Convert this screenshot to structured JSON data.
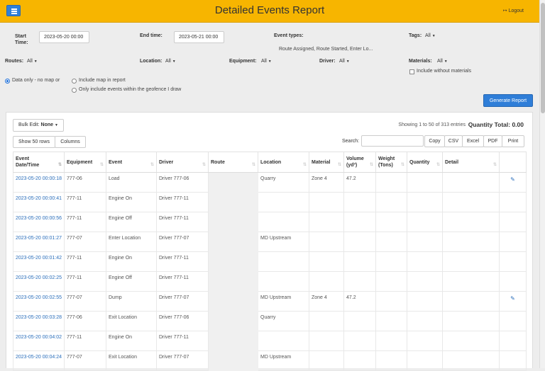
{
  "header": {
    "title": "Detailed Events Report",
    "logout_label": "Logout"
  },
  "filters": {
    "start_time_label": "Start Time:",
    "start_time_value": "2023-05-20 00:00",
    "end_time_label": "End time:",
    "end_time_value": "2023-05-21 00:00",
    "event_types_label": "Event types:",
    "event_types_value": "Route Assigned, Route Started, Enter Lo...",
    "tags_label": "Tags:",
    "tags_value": "All",
    "routes_label": "Routes:",
    "routes_value": "All",
    "location_label": "Location:",
    "location_value": "All",
    "equipment_label": "Equipment:",
    "equipment_value": "All",
    "driver_label": "Driver:",
    "driver_value": "All",
    "materials_label": "Materials:",
    "materials_value": "All",
    "include_without_materials": "Include without materials",
    "radio_data_only": "Data only - no map or",
    "radio_include_map": "Include map in report",
    "radio_geofence": "Only include events within the geofence I draw",
    "generate_button": "Generate Report"
  },
  "toolbar": {
    "bulk_edit_label": "Bulk Edit:",
    "bulk_edit_value": "None",
    "show_rows": "Show 50 rows",
    "columns": "Columns",
    "showing": "Showing 1 to 50 of 313 entries",
    "quantity_total": "Quantity Total: 0.00",
    "search_label": "Search:",
    "copy": "Copy",
    "csv": "CSV",
    "excel": "Excel",
    "pdf": "PDF",
    "print": "Print"
  },
  "table": {
    "headers": {
      "datetime_l1": "Event",
      "datetime_l2": "Date/Time",
      "equipment": "Equipment",
      "event": "Event",
      "driver": "Driver",
      "route": "Route",
      "location": "Location",
      "material": "Material",
      "volume_l1": "Volume",
      "volume_l2": "(yd³)",
      "weight_l1": "Weight",
      "weight_l2": "(Tons)",
      "quantity": "Quantity",
      "detail": "Detail"
    },
    "rows": [
      {
        "dt": "2023-05-20 00:00:18",
        "equipment": "777-06",
        "event": "Load",
        "driver": "Driver 777-06",
        "location": "Quarry",
        "material": "Zone 4",
        "volume": "47.2",
        "edit": true
      },
      {
        "dt": "2023-05-20 00:00:41",
        "equipment": "777-11",
        "event": "Engine On",
        "driver": "Driver 777-11",
        "location": "",
        "material": "",
        "volume": "",
        "edit": false
      },
      {
        "dt": "2023-05-20 00:00:56",
        "equipment": "777-11",
        "event": "Engine Off",
        "driver": "Driver 777-11",
        "location": "",
        "material": "",
        "volume": "",
        "edit": false
      },
      {
        "dt": "2023-05-20 00:01:27",
        "equipment": "777-07",
        "event": "Enter Location",
        "driver": "Driver 777-07",
        "location": "MD Upstream",
        "material": "",
        "volume": "",
        "edit": false
      },
      {
        "dt": "2023-05-20 00:01:42",
        "equipment": "777-11",
        "event": "Engine On",
        "driver": "Driver 777-11",
        "location": "",
        "material": "",
        "volume": "",
        "edit": false
      },
      {
        "dt": "2023-05-20 00:02:25",
        "equipment": "777-11",
        "event": "Engine Off",
        "driver": "Driver 777-11",
        "location": "",
        "material": "",
        "volume": "",
        "edit": false
      },
      {
        "dt": "2023-05-20 00:02:55",
        "equipment": "777-07",
        "event": "Dump",
        "driver": "Driver 777-07",
        "location": "MD Upstream",
        "material": "Zone 4",
        "volume": "47.2",
        "edit": true
      },
      {
        "dt": "2023-05-20 00:03:28",
        "equipment": "777-06",
        "event": "Exit Location",
        "driver": "Driver 777-06",
        "location": "Quarry",
        "material": "",
        "volume": "",
        "edit": false
      },
      {
        "dt": "2023-05-20 00:04:02",
        "equipment": "777-11",
        "event": "Engine On",
        "driver": "Driver 777-11",
        "location": "",
        "material": "",
        "volume": "",
        "edit": false
      },
      {
        "dt": "2023-05-20 00:04:24",
        "equipment": "777-07",
        "event": "Exit Location",
        "driver": "Driver 777-07",
        "location": "MD Upstream",
        "material": "",
        "volume": "",
        "edit": false
      }
    ]
  },
  "icons": {
    "menu": "hamburger-icon",
    "logout": "logout-icon",
    "sort": "sort-icon",
    "edit": "pencil-icon",
    "caret": "caret-down-icon"
  },
  "colors": {
    "header": "#f7b500",
    "primary": "#2f7ed8",
    "link": "#2a6ebb"
  }
}
